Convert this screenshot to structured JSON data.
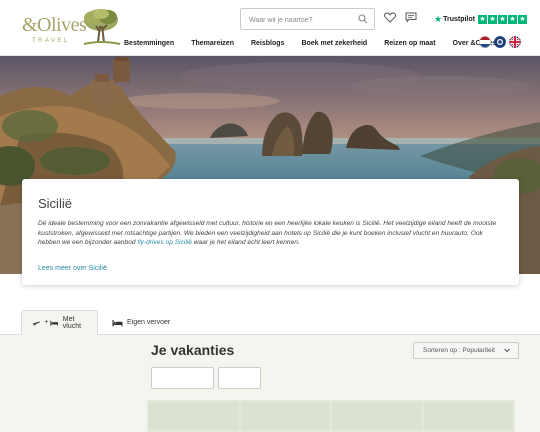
{
  "brand": {
    "logo_text": "&Olives",
    "logo_sub": "TRAVEL",
    "color": "#a8a56a"
  },
  "search": {
    "placeholder": "Waar wil je naartoe?"
  },
  "icons": {
    "search": "search-icon",
    "heart": "heart-icon",
    "chat": "chat-icon",
    "flags": [
      "netherlands-flag-icon",
      "belgium-flag-icon",
      "uk-flag-icon"
    ]
  },
  "trustpilot": {
    "label": "Trustpilot",
    "color": "#00b67a"
  },
  "nav": {
    "items": [
      "Bestemmingen",
      "Themareizen",
      "Reisblogs",
      "Boek met zekerheid",
      "Reizen op maat",
      "Over &Olives"
    ]
  },
  "hero": {
    "alt": "Kust van Sicilië met rotsformaties in zee"
  },
  "card": {
    "title": "Sicilië",
    "text_before": "Dé ideale bestemming voor een zonvakantie afgewisseld met cultuur, historie en een heerlijke lokale keuken is Sicilië. Het veelzijdige eiland heeft de mooiste kuststroken, afgewisseld met rotsachtige partijen. We bieden een veelzijdigheid aan hotels op Sicilië die je kunt boeken inclusief vlucht en huurauto. Ook hebben we een bijzonder aanbod ",
    "text_link": "fly-drives op Sicilië",
    "text_after": " waar je het eiland écht leert kennen.",
    "more_link": "Lees meer over Sicilië",
    "link_color": "#2a8ca8"
  },
  "tabs": [
    {
      "label": "Met vlucht",
      "active": true,
      "icons": "plane-icon + hotel-icon"
    },
    {
      "label": "Eigen vervoer",
      "active": false,
      "icons": "hotel-icon"
    }
  ],
  "results": {
    "title": "Je vakanties",
    "sort_label": "Sorteren op : Populariteit"
  }
}
